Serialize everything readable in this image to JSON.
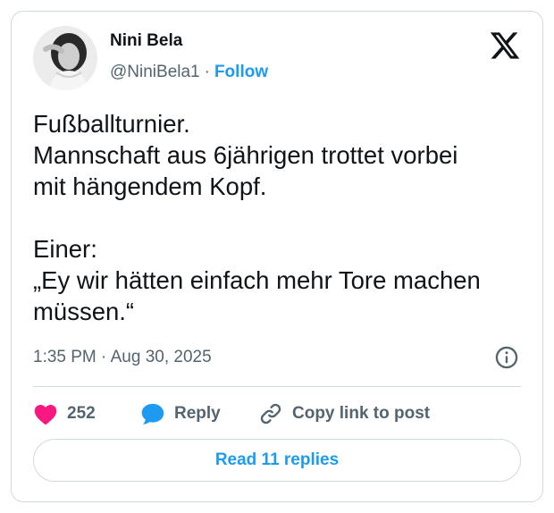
{
  "user": {
    "name": "Nini Bela",
    "handle": "@NiniBela1",
    "separator": "·",
    "follow_label": "Follow"
  },
  "tweet": {
    "paragraphs": [
      [
        "Fußballturnier.",
        "Mannschaft aus 6jährigen trottet vorbei",
        "mit hängendem Kopf."
      ],
      [
        "Einer:",
        "„Ey wir hätten einfach mehr Tore machen",
        "müssen.“"
      ]
    ],
    "time": "1:35 PM",
    "meta_separator": "·",
    "date": "Aug 30, 2025"
  },
  "actions": {
    "like_count": "252",
    "reply_label": "Reply",
    "copy_label": "Copy link to post"
  },
  "read_replies_label": "Read 11 replies",
  "icons": {
    "logo": "x-logo-icon",
    "info": "info-icon",
    "like": "heart-icon",
    "reply": "speech-bubble-icon",
    "copy": "link-icon"
  },
  "colors": {
    "accent": "#1d9bf0",
    "like": "#f91880",
    "text": "#0f1419",
    "muted": "#536471",
    "border": "#cfd9de"
  }
}
